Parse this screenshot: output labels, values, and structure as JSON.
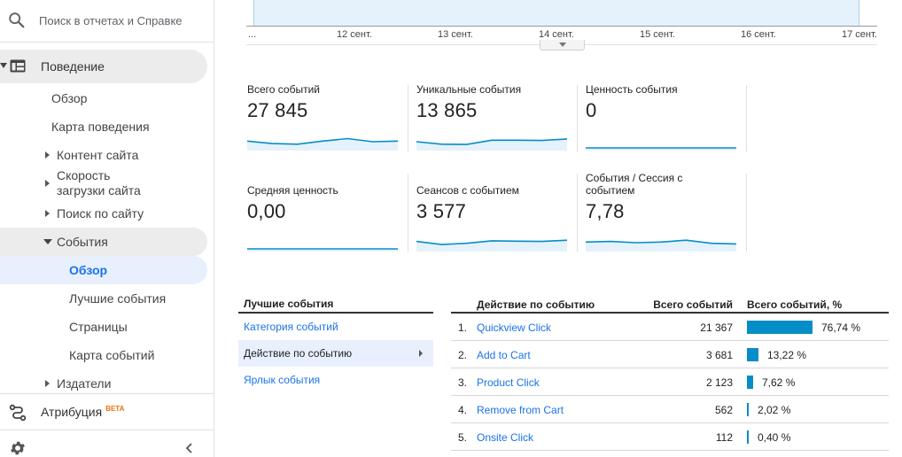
{
  "search": {
    "placeholder": "Поиск в отчетах и Справке"
  },
  "sidebar": {
    "behavior": "Поведение",
    "overview": "Обзор",
    "behavior_map": "Карта поведения",
    "site_content": "Контент сайта",
    "site_speed_line1": "Скорость",
    "site_speed_line2": "загрузки сайта",
    "site_search": "Поиск по сайту",
    "events": "События",
    "events_overview": "Обзор",
    "top_events": "Лучшие события",
    "pages": "Страницы",
    "events_flow": "Карта событий",
    "publishers": "Издатели",
    "attribution": "Атрибуция",
    "beta": "BETA"
  },
  "chart": {
    "x_ticks": [
      "...",
      "12 сент.",
      "13 сент.",
      "14 сент.",
      "15 сент.",
      "16 сент.",
      "17 сент."
    ]
  },
  "metrics": [
    {
      "label": "Всего событий",
      "value": "27 845",
      "spark": [
        0.55,
        0.35,
        0.3,
        0.55,
        0.75,
        0.5,
        0.55
      ]
    },
    {
      "label": "Уникальные события",
      "value": "13 865",
      "spark": [
        0.5,
        0.3,
        0.28,
        0.62,
        0.62,
        0.6,
        0.72
      ]
    },
    {
      "label": "Ценность события",
      "value": "0",
      "spark": [
        0,
        0,
        0,
        0,
        0,
        0,
        0
      ]
    },
    {
      "label": "Средняя ценность",
      "value": "0,00",
      "spark": [
        0,
        0,
        0,
        0,
        0,
        0,
        0
      ]
    },
    {
      "label": "Сеансов с событием",
      "value": "3 577",
      "spark": [
        0.6,
        0.35,
        0.45,
        0.65,
        0.62,
        0.6,
        0.7
      ]
    },
    {
      "label": "События / Сессия с событием",
      "value": "7,78",
      "spark": [
        0.55,
        0.6,
        0.5,
        0.55,
        0.7,
        0.45,
        0.4
      ]
    }
  ],
  "dimensions": {
    "heading": "Лучшие события",
    "items": [
      "Категория событий",
      "Действие по событию",
      "Ярлык события"
    ]
  },
  "table": {
    "headers": {
      "action": "Действие по событию",
      "total": "Всего событий",
      "pct": "Всего событий, %"
    },
    "rows": [
      {
        "n": "1.",
        "action": "Quickview Click",
        "total": "21 367",
        "pct": "76,74 %",
        "share": 0.7674
      },
      {
        "n": "2.",
        "action": "Add to Cart",
        "total": "3 681",
        "pct": "13,22 %",
        "share": 0.1322
      },
      {
        "n": "3.",
        "action": "Product Click",
        "total": "2 123",
        "pct": "7,62 %",
        "share": 0.0762
      },
      {
        "n": "4.",
        "action": "Remove from Cart",
        "total": "562",
        "pct": "2,02 %",
        "share": 0.0202
      },
      {
        "n": "5.",
        "action": "Onsite Click",
        "total": "112",
        "pct": "0,40 %",
        "share": 0.004
      }
    ]
  },
  "colors": {
    "accent": "#1a73e8",
    "bar": "#058dc7",
    "spark_line": "#058dc7",
    "spark_fill": "#e5f2fb"
  },
  "icons": [
    "search-icon",
    "behavior-icon",
    "attribution-icon",
    "gear-icon",
    "chevron-left-icon"
  ]
}
